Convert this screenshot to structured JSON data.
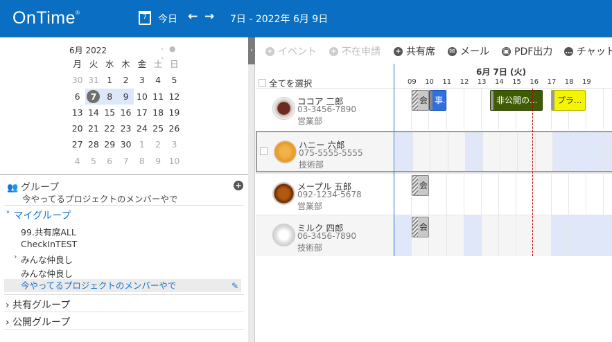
{
  "header": {
    "logo": "OnTime",
    "logo_mark": "®",
    "cal_icon_day": "7",
    "today_label": "今日",
    "prev_arrow": "←",
    "next_arrow": "→",
    "range": "7日 - 2022年 6月 9日"
  },
  "mini_calendar": {
    "title": "6月 2022",
    "nav": "‹ ● ›",
    "dow": [
      "月",
      "火",
      "水",
      "木",
      "金",
      "土",
      "日"
    ],
    "weeks": [
      [
        "30",
        "31",
        "1",
        "2",
        "3",
        "4",
        "5"
      ],
      [
        "6",
        "7",
        "8",
        "9",
        "10",
        "11",
        "12"
      ],
      [
        "13",
        "14",
        "15",
        "16",
        "17",
        "18",
        "19"
      ],
      [
        "20",
        "21",
        "22",
        "23",
        "24",
        "25",
        "26"
      ],
      [
        "27",
        "28",
        "29",
        "30",
        "1",
        "2",
        "3"
      ],
      [
        "4",
        "5",
        "6",
        "7",
        "8",
        "9",
        "10"
      ]
    ],
    "selected": "7"
  },
  "groups": {
    "title": "グループ",
    "current": "今やってるプロジェクトのメンバーやで",
    "add_icon": "plus-circle-icon",
    "my_groups_label": "マイグループ",
    "items": [
      "99.共有席ALL",
      "CheckInTEST",
      "みんな仲良し",
      "みんな仲良し",
      "今やってるプロジェクトのメンバーやで"
    ],
    "shared_label": "共有グループ",
    "public_label": "公開グループ"
  },
  "toolbar": {
    "event": "イベント",
    "absence": "不在申請",
    "shared_seat": "共有席",
    "mail": "メール",
    "pdf": "PDF出力",
    "chat": "チャット"
  },
  "schedule": {
    "select_all": "全てを選択",
    "day_header": "6月 7日 (火)",
    "hours": [
      "09",
      "10",
      "11",
      "12",
      "13",
      "14",
      "15",
      "16",
      "17",
      "18",
      "19"
    ],
    "people": [
      {
        "name": "ココア 二郎",
        "phone": "03-3456-7890",
        "dept": "営業部"
      },
      {
        "name": "ハニー 六郎",
        "phone": "075-5555-5555",
        "dept": "技術部"
      },
      {
        "name": "メープル 五郎",
        "phone": "092-1234-5678",
        "dept": "営業部"
      },
      {
        "name": "ミルク 四郎",
        "phone": "06-3456-7890",
        "dept": "技術部"
      }
    ],
    "events": {
      "r1_a": "会...",
      "r1_b": "事...",
      "r1_c": "非公開の...",
      "r1_d": "プラ...",
      "r3_a": "会...",
      "r4_a": "会..."
    },
    "colors": {
      "blue": "#2f6fe0",
      "green": "#3f5c05",
      "yellow": "#f5f500",
      "gray": "#c8c8c8"
    }
  }
}
